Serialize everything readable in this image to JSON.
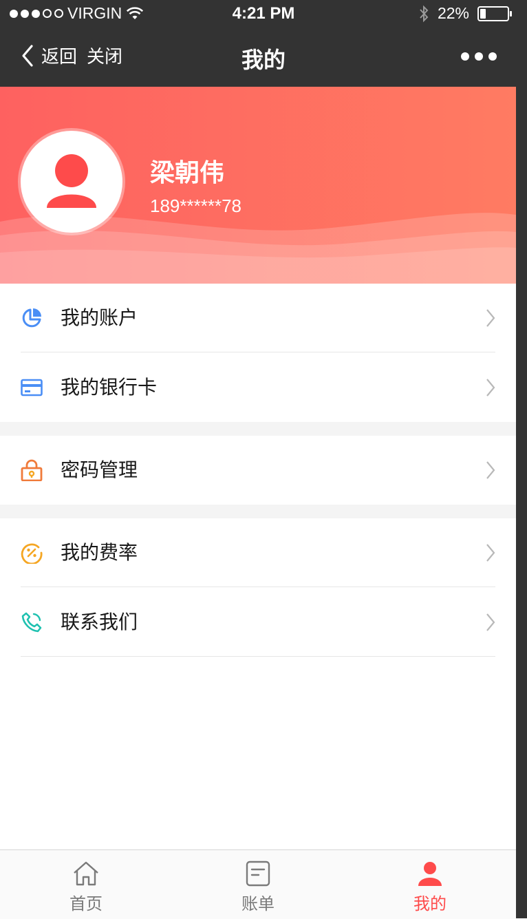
{
  "status_bar": {
    "carrier": "VIRGIN",
    "time": "4:21 PM",
    "battery": "22%"
  },
  "nav": {
    "back_label": "返回",
    "close_label": "关闭",
    "title": "我的"
  },
  "profile": {
    "name": "梁朝伟",
    "phone": "189******78"
  },
  "menu": [
    {
      "label": "我的账户",
      "icon": "pie-chart-icon",
      "color": "#4a8ef5"
    },
    {
      "label": "我的银行卡",
      "icon": "bank-card-icon",
      "color": "#4a8ef5"
    },
    {
      "label": "密码管理",
      "icon": "lock-icon",
      "color": "#f07a3a"
    },
    {
      "label": "我的费率",
      "icon": "rate-percent-icon",
      "color": "#f5a623"
    },
    {
      "label": "联系我们",
      "icon": "phone-icon",
      "color": "#1fc1b0"
    }
  ],
  "tabs": [
    {
      "label": "首页",
      "icon": "home-icon"
    },
    {
      "label": "账单",
      "icon": "bill-icon"
    },
    {
      "label": "我的",
      "icon": "user-icon"
    }
  ],
  "colors": {
    "accent": "#fe4b4b",
    "hero_start": "#fe6160",
    "hero_end": "#ff7b62",
    "text": "#181818"
  }
}
